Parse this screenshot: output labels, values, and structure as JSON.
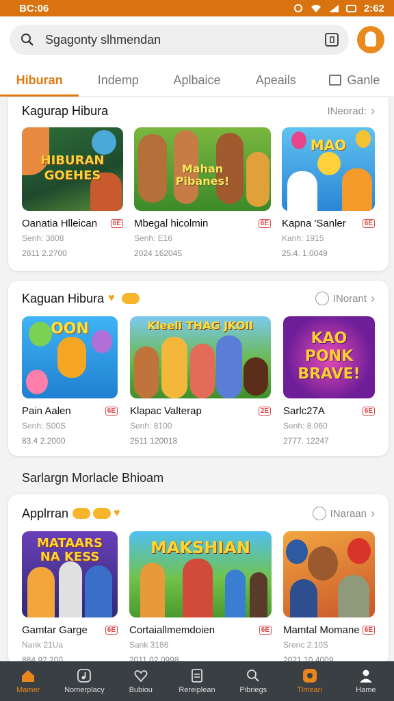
{
  "status": {
    "time": "BC:06",
    "right": "2:62"
  },
  "search": {
    "text": "Sgagonty slhmendan"
  },
  "tabs": [
    {
      "label": "Hiburan",
      "active": true
    },
    {
      "label": "Indemp"
    },
    {
      "label": "Aplbaice"
    },
    {
      "label": "Apeails"
    },
    {
      "label": "Ganle",
      "icon": "list-icon"
    }
  ],
  "sections": [
    {
      "title": "Kagurap Hibura",
      "more": "INeorad:",
      "games": [
        {
          "title": "Oanatia Hlleican",
          "tag": "6E",
          "sub": "Senh: 3808",
          "stat": "2811 2.2700",
          "art": "HIBURAN GOEHES"
        },
        {
          "title": "Mbegal hicolmin",
          "tag": "6E",
          "sub": "Senh: E16",
          "stat": "2024 162045",
          "art": "Mahan Pibanes!"
        },
        {
          "title": "Kapna 'Sanler",
          "tag": "6E",
          "sub": "Kanh: 1915",
          "stat": "25.4. 1.0049",
          "art": "MAO"
        }
      ]
    },
    {
      "title": "Kaguan Hibura",
      "more": "INorant",
      "games": [
        {
          "title": "Pain Aalen",
          "tag": "6E",
          "sub": "Senh: S00S",
          "stat": "83.4 2.2000",
          "art": "OON"
        },
        {
          "title": "Klapac Valterap",
          "tag": "2E",
          "sub": "Senh: 8100",
          "stat": "2511 120018",
          "art": "Kleeli THAG JKOII"
        },
        {
          "title": "Sarlc27A",
          "tag": "6E",
          "sub": "Senh: 8.060",
          "stat": "2777. 12247",
          "art": "KAO PONK BRAVE!"
        }
      ]
    }
  ],
  "section_label": "Sarlargn Morlacle Bhioam",
  "third": {
    "title": "Applrran",
    "more": "INaraan",
    "games": [
      {
        "title": "Gamtar Garge",
        "tag": "6E",
        "sub": "Nank 21Ua",
        "stat": "884 92.200",
        "art": "MATAARS NA KESS"
      },
      {
        "title": "Cortaiallmemdoien",
        "tag": "6E",
        "sub": "Sank 3186",
        "stat": "2011 02.0998",
        "art": "MAKSHIAN"
      },
      {
        "title": "Mamtal Momane",
        "tag": "6E",
        "sub": "Srenc 2.10S",
        "stat": "2021 10.4009",
        "art": ""
      }
    ]
  },
  "bottom_nav": [
    {
      "label": "Mamer",
      "icon": "home-icon",
      "active": true
    },
    {
      "label": "Nomerplacy",
      "icon": "music-icon"
    },
    {
      "label": "Bubiou",
      "icon": "heart-icon"
    },
    {
      "label": "Rereiplean",
      "icon": "document-icon"
    },
    {
      "label": "Pibriegs",
      "icon": "search-icon"
    },
    {
      "label": "Tlmeari",
      "icon": "game-icon",
      "active": true
    },
    {
      "label": "Hame",
      "icon": "profile-icon"
    }
  ]
}
